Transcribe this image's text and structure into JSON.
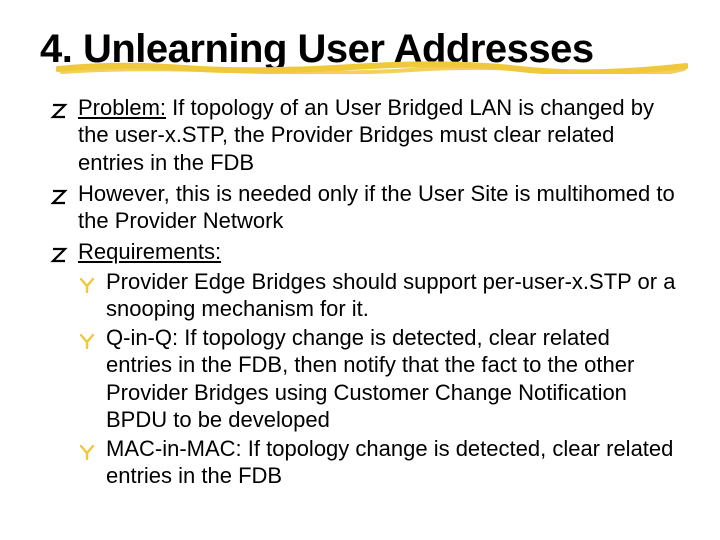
{
  "title": "4. Unlearning User Addresses",
  "bullets": [
    {
      "prefix": "Problem:",
      "rest": " If topology of an User Bridged LAN is changed by the user-x.STP, the Provider Bridges must clear related entries in the FDB"
    },
    {
      "text": "However, this is needed only if the User Site is multihomed to the Provider Network"
    },
    {
      "prefix": "Requirements:",
      "rest": "",
      "children": [
        {
          "text": "Provider Edge Bridges should support per-user-x.STP or a snooping mechanism for it."
        },
        {
          "text": "Q-in-Q: If topology change is detected, clear related entries in the FDB, then notify that the fact to the other Provider Bridges using Customer Change Notification BPDU to be developed"
        },
        {
          "text": "MAC-in-MAC: If topology change is detected, clear related entries in the FDB"
        }
      ]
    }
  ],
  "colors": {
    "accent": "#f0c83c",
    "text": "#000000"
  }
}
